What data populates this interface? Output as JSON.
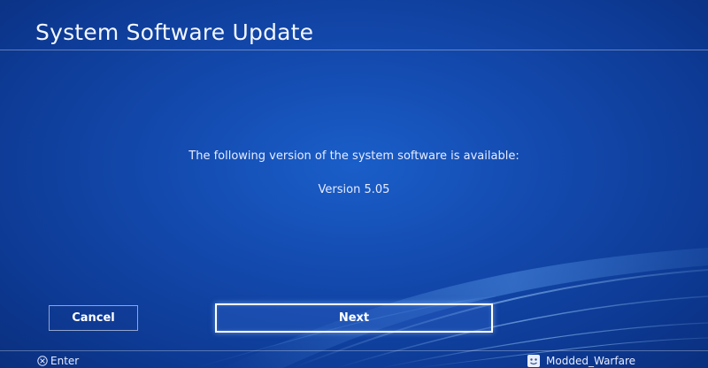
{
  "screen": {
    "title": "System Software Update"
  },
  "dialog": {
    "message": "The following version of the system software is available:",
    "version": "Version 5.05"
  },
  "buttons": {
    "cancel_label": "Cancel",
    "next_label": "Next"
  },
  "footer": {
    "enter_label": "Enter",
    "enter_icon": "cross-button-icon",
    "user_name": "Modded_Warfare",
    "user_icon": "avatar-icon"
  },
  "colors": {
    "background": "#1349ad",
    "text": "#ffffff"
  }
}
